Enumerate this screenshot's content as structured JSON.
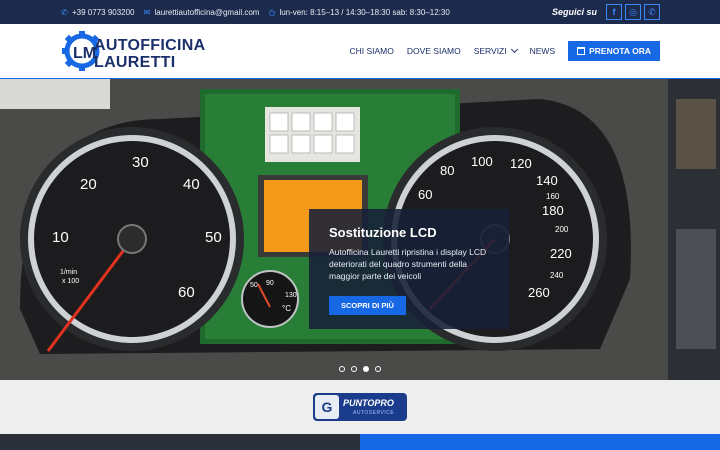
{
  "topbar": {
    "phone": "+39 0773 903200",
    "email": "laurettiautofficina@gmail.com",
    "hours": "lun-ven: 8:15–13 / 14:30–18:30 sab: 8:30–12:30",
    "follow_label": "Seguici su",
    "social": [
      {
        "name": "facebook",
        "glyph": "f"
      },
      {
        "name": "instagram",
        "glyph": "◎"
      },
      {
        "name": "whatsapp",
        "glyph": "✆"
      }
    ]
  },
  "brand": {
    "line1": "AUTOFFICINA",
    "line2": "LAURETTI"
  },
  "nav": {
    "items": [
      "CHI SIAMO",
      "DOVE SIAMO",
      "SERVIZI",
      "NEWS"
    ],
    "cta": "PRENOTA ORA"
  },
  "hero": {
    "title": "Sostituzione LCD",
    "text": "Autofficina Lauretti ripristina i display LCD deteriorati del quadro strumenti della maggior parte dei veicoli",
    "button": "SCOPRI DI PIÙ",
    "slides": 4,
    "active_slide": 3
  },
  "gauge_left": {
    "labels": [
      "10",
      "20",
      "30",
      "40",
      "50",
      "60"
    ],
    "unit": "1/min x 100"
  },
  "gauge_right": {
    "labels": [
      "60",
      "80",
      "100",
      "120",
      "140",
      "160",
      "180",
      "200",
      "220",
      "240",
      "260"
    ]
  },
  "gauge_temp": {
    "labels": [
      "50",
      "90",
      "130",
      "°C"
    ]
  },
  "partner": {
    "name": "PUNTOPRO",
    "sub": "AUTOSERVICE",
    "badge": "G"
  },
  "colors": {
    "accent": "#1768e4",
    "navy": "#1c2a4c",
    "brand": "#1b2f6b"
  }
}
